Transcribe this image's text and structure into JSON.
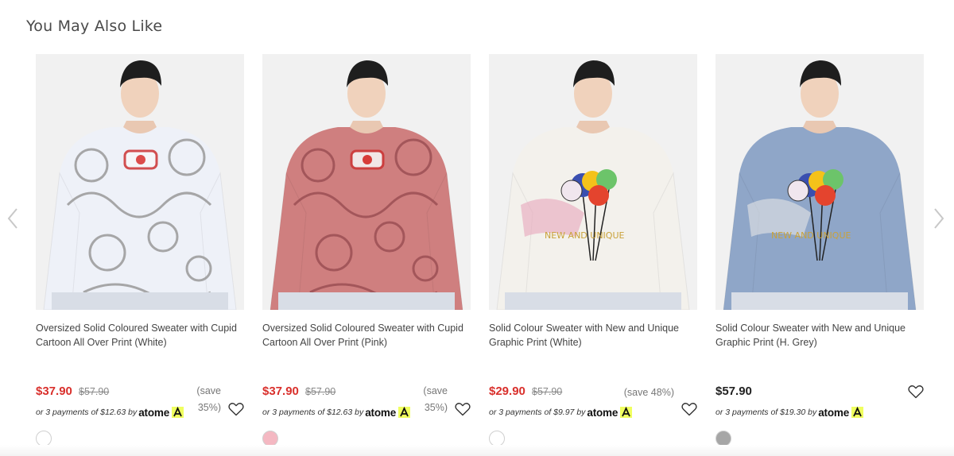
{
  "section": {
    "title": "You May Also Like"
  },
  "carousel": {
    "prev_icon": "chevron-left-icon",
    "next_icon": "chevron-right-icon"
  },
  "atome": {
    "brand": "atome",
    "badge_letter": "A",
    "badge_color": "#f0ff5f"
  },
  "colors": {
    "sale_price": "#d9302c",
    "regular_price": "#222222"
  },
  "products": [
    {
      "name": "Oversized Solid Coloured Sweater with Cupid Cartoon All Over Print (White)",
      "price": "$37.90",
      "original_price": "$57.90",
      "save": "(save 35%)",
      "installment": "or 3 payments of $12.63 by",
      "swatch_color": "#ffffff",
      "sweater_color": "#eef1f8",
      "print_color": "#9a9a9a"
    },
    {
      "name": "Oversized Solid Coloured Sweater with Cupid Cartoon All Over Print (Pink)",
      "price": "$37.90",
      "original_price": "$57.90",
      "save": "(save 35%)",
      "installment": "or 3 payments of $12.63 by",
      "swatch_color": "#f4b8c2",
      "sweater_color": "#cf7f7f",
      "print_color": "#9c4f54"
    },
    {
      "name": "Solid Colour Sweater with New and Unique Graphic Print (White)",
      "price": "$29.90",
      "original_price": "$57.90",
      "save": "(save 48%)",
      "installment": "or 3 payments of $9.97 by",
      "swatch_color": "#ffffff",
      "sweater_color": "#f3f1ec",
      "print_color": "#e8a7bc"
    },
    {
      "name": "Solid Colour Sweater with New and Unique Graphic Print (H. Grey)",
      "price": "$57.90",
      "original_price": "",
      "save": "",
      "installment": "or 3 payments of $19.30 by",
      "swatch_color": "#a6a6a6",
      "sweater_color": "#8fa6c8",
      "print_color": "#e6e6e6"
    }
  ]
}
